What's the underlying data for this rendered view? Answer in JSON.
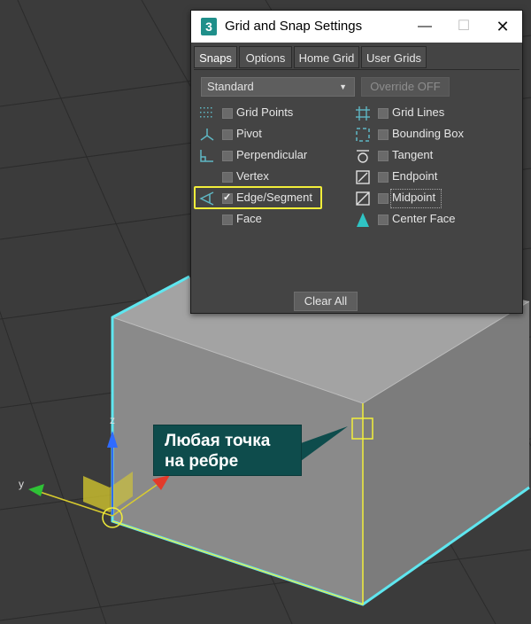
{
  "dialog": {
    "title": "Grid and Snap Settings",
    "icon_label": "3",
    "controls": {
      "minimize": "—",
      "maximize": "☐",
      "close": "✕"
    }
  },
  "tabs": [
    "Snaps",
    "Options",
    "Home Grid",
    "User Grids"
  ],
  "snaps": {
    "set_selected": "Standard",
    "override_label": "Override OFF",
    "items_left": [
      {
        "label": "Grid Points",
        "checked": false,
        "icon": "grid-points-icon"
      },
      {
        "label": "Pivot",
        "checked": false,
        "icon": "pivot-icon"
      },
      {
        "label": "Perpendicular",
        "checked": false,
        "icon": "perpendicular-icon"
      },
      {
        "label": "Vertex",
        "checked": false,
        "icon": "vertex-icon"
      },
      {
        "label": "Edge/Segment",
        "checked": true,
        "icon": "edge-segment-icon"
      },
      {
        "label": "Face",
        "checked": false,
        "icon": "face-icon"
      }
    ],
    "items_right": [
      {
        "label": "Grid Lines",
        "checked": false,
        "icon": "grid-lines-icon"
      },
      {
        "label": "Bounding Box",
        "checked": false,
        "icon": "bounding-box-icon"
      },
      {
        "label": "Tangent",
        "checked": false,
        "icon": "tangent-icon"
      },
      {
        "label": "Endpoint",
        "checked": false,
        "icon": "endpoint-icon"
      },
      {
        "label": "Midpoint",
        "checked": false,
        "icon": "midpoint-icon"
      },
      {
        "label": "Center Face",
        "checked": false,
        "icon": "center-face-icon"
      }
    ],
    "clear_all_label": "Clear All"
  },
  "viewport": {
    "axis_labels": {
      "x": "x",
      "y": "y",
      "z": "z"
    },
    "colors": {
      "selection": "#5fe6ef",
      "highlight": "#f2ee3a",
      "callout_bg": "#0e4c4c"
    }
  },
  "callout": {
    "line1": "Любая точка",
    "line2": "на ребре"
  }
}
